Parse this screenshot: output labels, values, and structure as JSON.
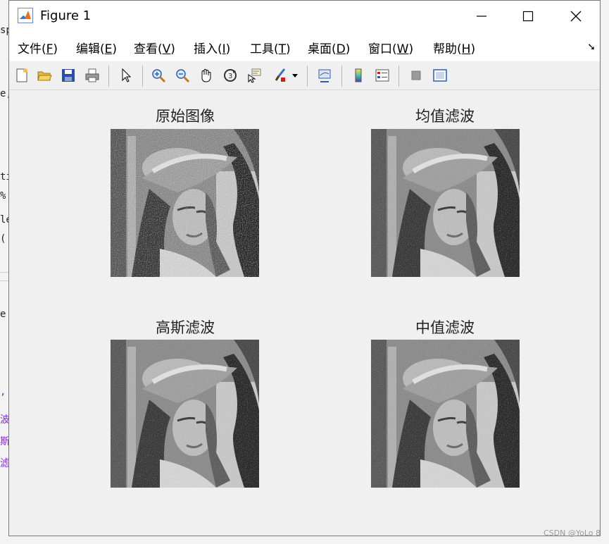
{
  "window": {
    "title": "Figure 1"
  },
  "menu": [
    {
      "label": "文件(",
      "acc": "F",
      "tail": ")"
    },
    {
      "label": "编辑(",
      "acc": "E",
      "tail": ")"
    },
    {
      "label": "查看(",
      "acc": "V",
      "tail": ")"
    },
    {
      "label": "插入(",
      "acc": "I",
      "tail": ")"
    },
    {
      "label": "工具(",
      "acc": "T",
      "tail": ")"
    },
    {
      "label": "桌面(",
      "acc": "D",
      "tail": ")"
    },
    {
      "label": "窗口(",
      "acc": "W",
      "tail": ")"
    },
    {
      "label": "帮助(",
      "acc": "H",
      "tail": ")"
    }
  ],
  "axes": [
    {
      "title": "原始图像"
    },
    {
      "title": "均值滤波"
    },
    {
      "title": "高斯滤波"
    },
    {
      "title": "中值滤波"
    }
  ],
  "background_fragments": [
    "sp",
    "e,",
    "ti",
    "%",
    "le",
    "('",
    "e",
    ",",
    "波",
    "斯",
    "滤"
  ],
  "watermark": "CSDN @YoLo 8"
}
